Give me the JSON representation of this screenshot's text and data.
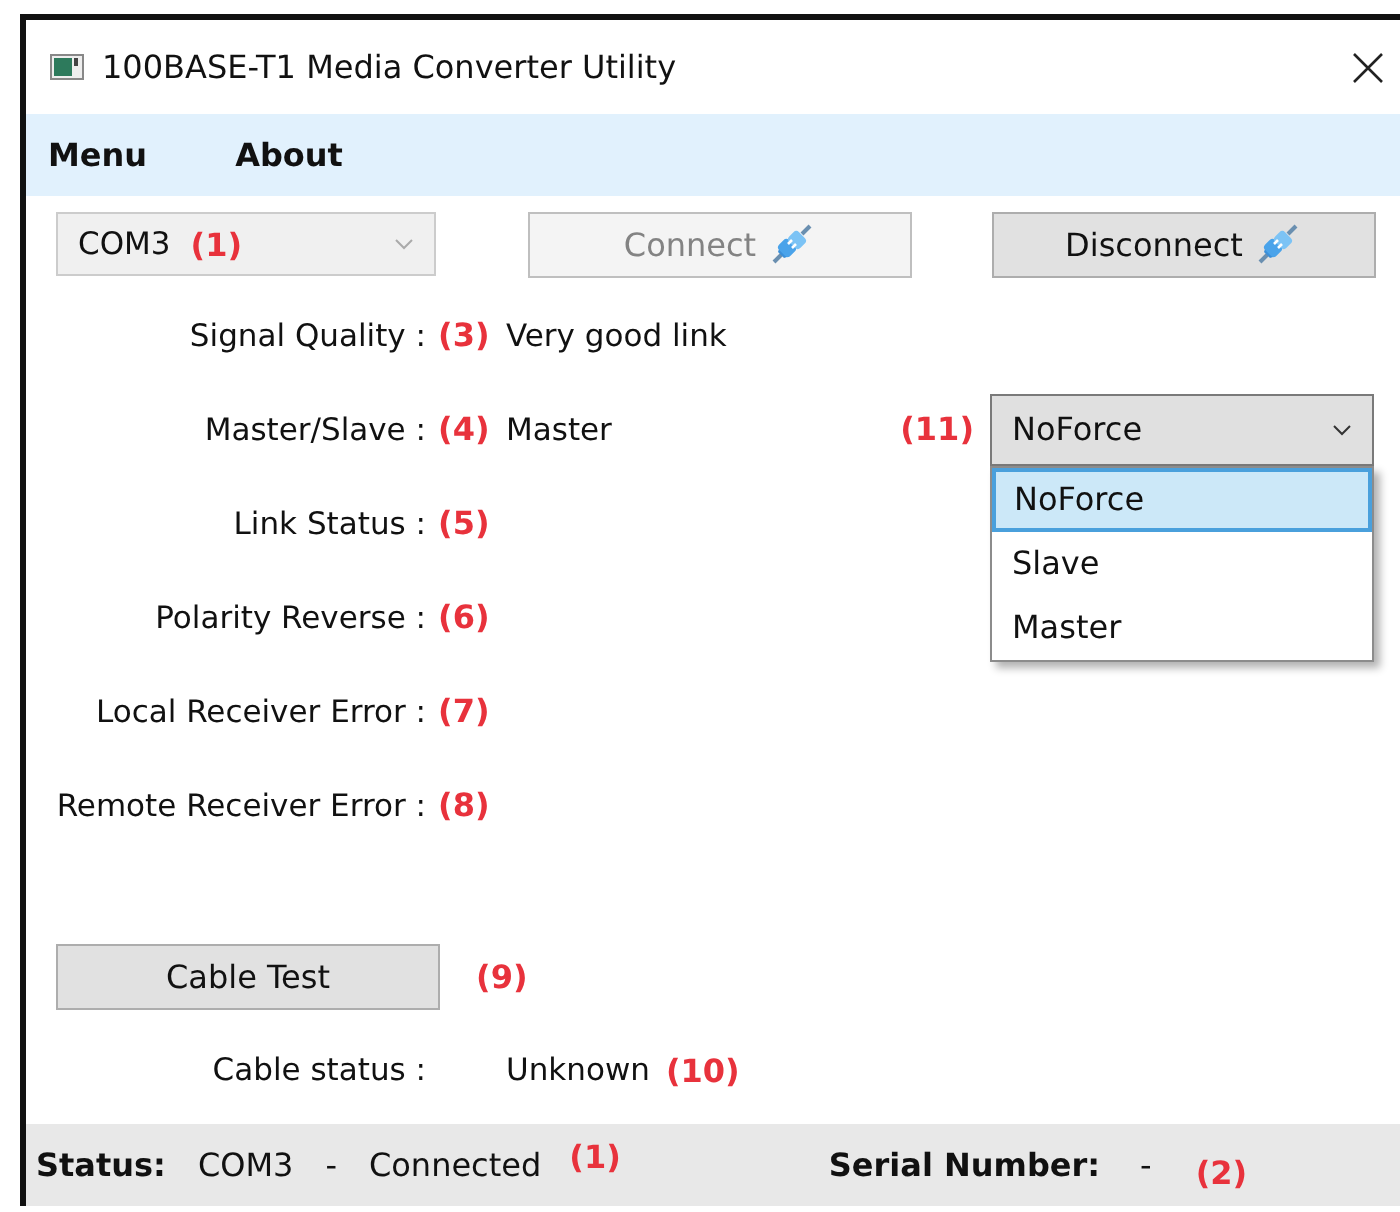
{
  "window": {
    "title": "100BASE-T1 Media Converter Utility"
  },
  "menu": [
    "Menu",
    "About"
  ],
  "toolbar": {
    "port_select": {
      "value": "COM3",
      "annotation": "(1)",
      "disabled": true
    },
    "buttons": [
      {
        "label": "Connect",
        "disabled": true
      },
      {
        "label": "Disconnect",
        "disabled": false
      }
    ]
  },
  "fields": [
    {
      "label": "Signal Quality :",
      "annotation": "(3)",
      "value": "Very good link"
    },
    {
      "label": "Master/Slave :",
      "annotation": "(4)",
      "value": "Master",
      "force_select": {
        "annotation": "(11)",
        "value": "NoForce",
        "expanded": true,
        "options": [
          {
            "label": "NoForce",
            "selected": true
          },
          {
            "label": "Slave",
            "selected": false
          },
          {
            "label": "Master",
            "selected": false
          }
        ]
      }
    },
    {
      "label": "Link Status :",
      "annotation": "(5)"
    },
    {
      "label": "Polarity Reverse :",
      "annotation": "(6)"
    },
    {
      "label": "Local Receiver Error :",
      "annotation": "(7)"
    },
    {
      "label": "Remote Receiver Error :",
      "annotation": "(8)"
    }
  ],
  "cable_test": {
    "label": "Cable Test",
    "annotation": "(9)"
  },
  "cable_status": {
    "label": "Cable status :",
    "value": "Unknown",
    "annotation": "(10)"
  },
  "status_bar": {
    "label": "Status:",
    "port": "COM3",
    "separator": "-",
    "state": "Connected",
    "annotation": "(1)",
    "serial_label": "Serial Number:",
    "serial_value": "-",
    "serial_annotation": "(2)"
  }
}
